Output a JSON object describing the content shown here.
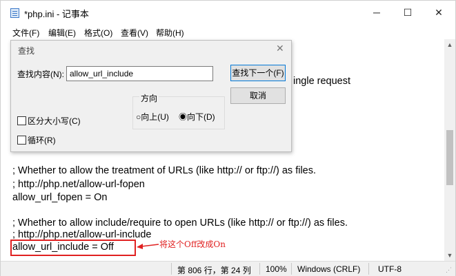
{
  "window": {
    "title": "*php.ini - 记事本",
    "minimize_glyph": "─",
    "maximize_glyph": "☐",
    "close_glyph": "✕"
  },
  "menu": [
    "文件(F)",
    "编辑(E)",
    "格式(O)",
    "查看(V)",
    "帮助(H)"
  ],
  "editor": {
    "lines": [
      "ingle request",
      "; Whether to allow the treatment of URLs (like http:// or ftp://) as files.",
      "; http://php.net/allow-url-fopen",
      "allow_url_fopen = On",
      "; Whether to allow include/require to open URLs (like http:// or ftp://) as files.",
      "; http://php.net/allow-url-include",
      "allow_url_include = Off"
    ]
  },
  "find_dialog": {
    "title": "查找",
    "find_label": "查找内容(N):",
    "find_value": "allow_url_include",
    "find_next_label": "查找下一个(F)",
    "cancel_label": "取消",
    "direction_label": "方向",
    "up_label": "向上(U)",
    "down_label": "向下(D)",
    "selected_direction": "down",
    "match_case_label": "区分大小写(C)",
    "match_case_checked": false,
    "wrap_label": "循环(R)",
    "wrap_checked": false
  },
  "statusbar": {
    "position": "第 806 行，第 24 列",
    "zoom": "100%",
    "line_ending": "Windows (CRLF)",
    "encoding": "UTF-8"
  },
  "annotation": {
    "text": "将这个Off改成On",
    "color": "#e02020"
  },
  "icons": {
    "app": "notepad-icon",
    "scroll_up": "chevron-up-icon",
    "scroll_down": "chevron-down-icon"
  }
}
